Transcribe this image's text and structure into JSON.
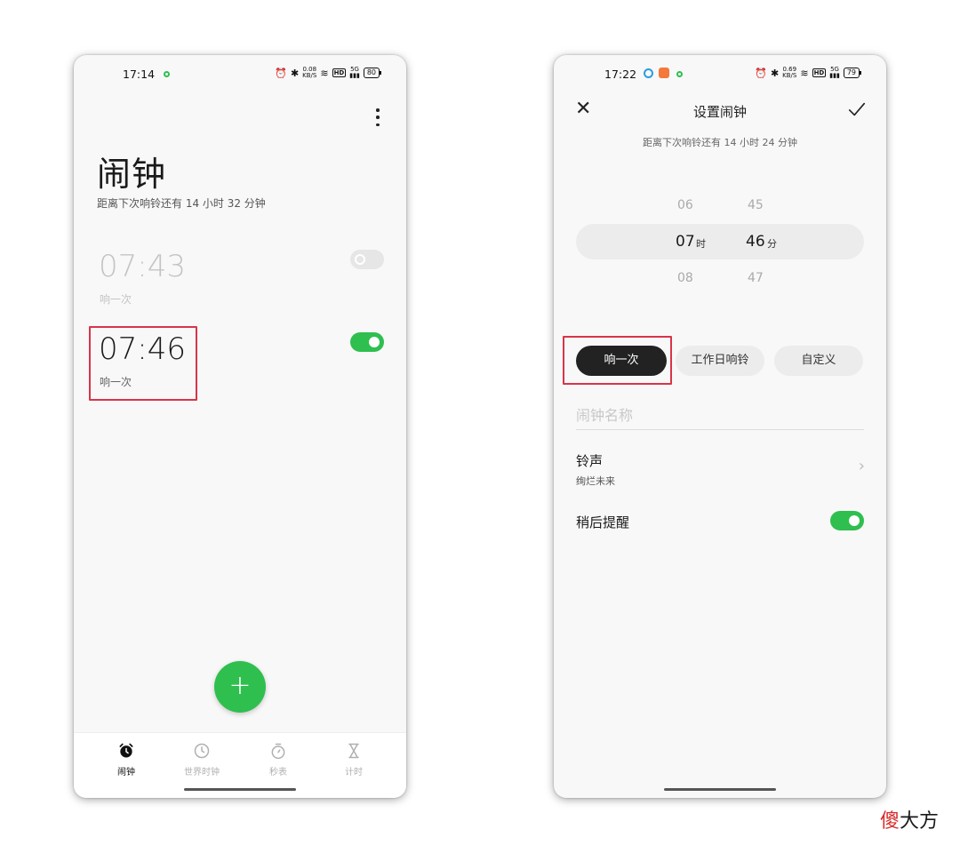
{
  "left": {
    "status": {
      "time": "17:14",
      "speed_top": "0.08",
      "speed_unit": "KB/S",
      "battery": "80",
      "net": "5G"
    },
    "title": "闹钟",
    "next_alarm_info": "距离下次响铃还有 14 小时 32 分钟",
    "alarms": [
      {
        "time": "07:43",
        "repeat": "响一次",
        "enabled": false
      },
      {
        "time": "07:46",
        "repeat": "响一次",
        "enabled": true
      }
    ],
    "fab_label": "+",
    "nav": [
      {
        "label": "闹钟",
        "icon": "alarm-clock-icon",
        "active": true
      },
      {
        "label": "世界时钟",
        "icon": "world-clock-icon",
        "active": false
      },
      {
        "label": "秒表",
        "icon": "stopwatch-icon",
        "active": false
      },
      {
        "label": "计时",
        "icon": "hourglass-icon",
        "active": false
      }
    ]
  },
  "right": {
    "status": {
      "time": "17:22",
      "speed_top": "0.69",
      "speed_unit": "KB/S",
      "battery": "79",
      "net": "5G"
    },
    "title": "设置闹钟",
    "next_alarm_info": "距离下次响铃还有 14 小时 24 分钟",
    "picker": {
      "hours": [
        "06",
        "07",
        "08"
      ],
      "minutes": [
        "45",
        "46",
        "47"
      ],
      "hour_unit": "时",
      "minute_unit": "分"
    },
    "repeat_options": [
      "响一次",
      "工作日响铃",
      "自定义"
    ],
    "selected_repeat": "响一次",
    "name_placeholder": "闹钟名称",
    "ringtone": {
      "label": "铃声",
      "value": "绚烂未来"
    },
    "snooze": {
      "label": "稍后提醒",
      "enabled": true
    }
  },
  "watermark": {
    "red": "傻",
    "black": "大方"
  },
  "colors": {
    "accent": "#2fbf4f",
    "highlight": "#d8344a",
    "active_button": "#222222"
  }
}
